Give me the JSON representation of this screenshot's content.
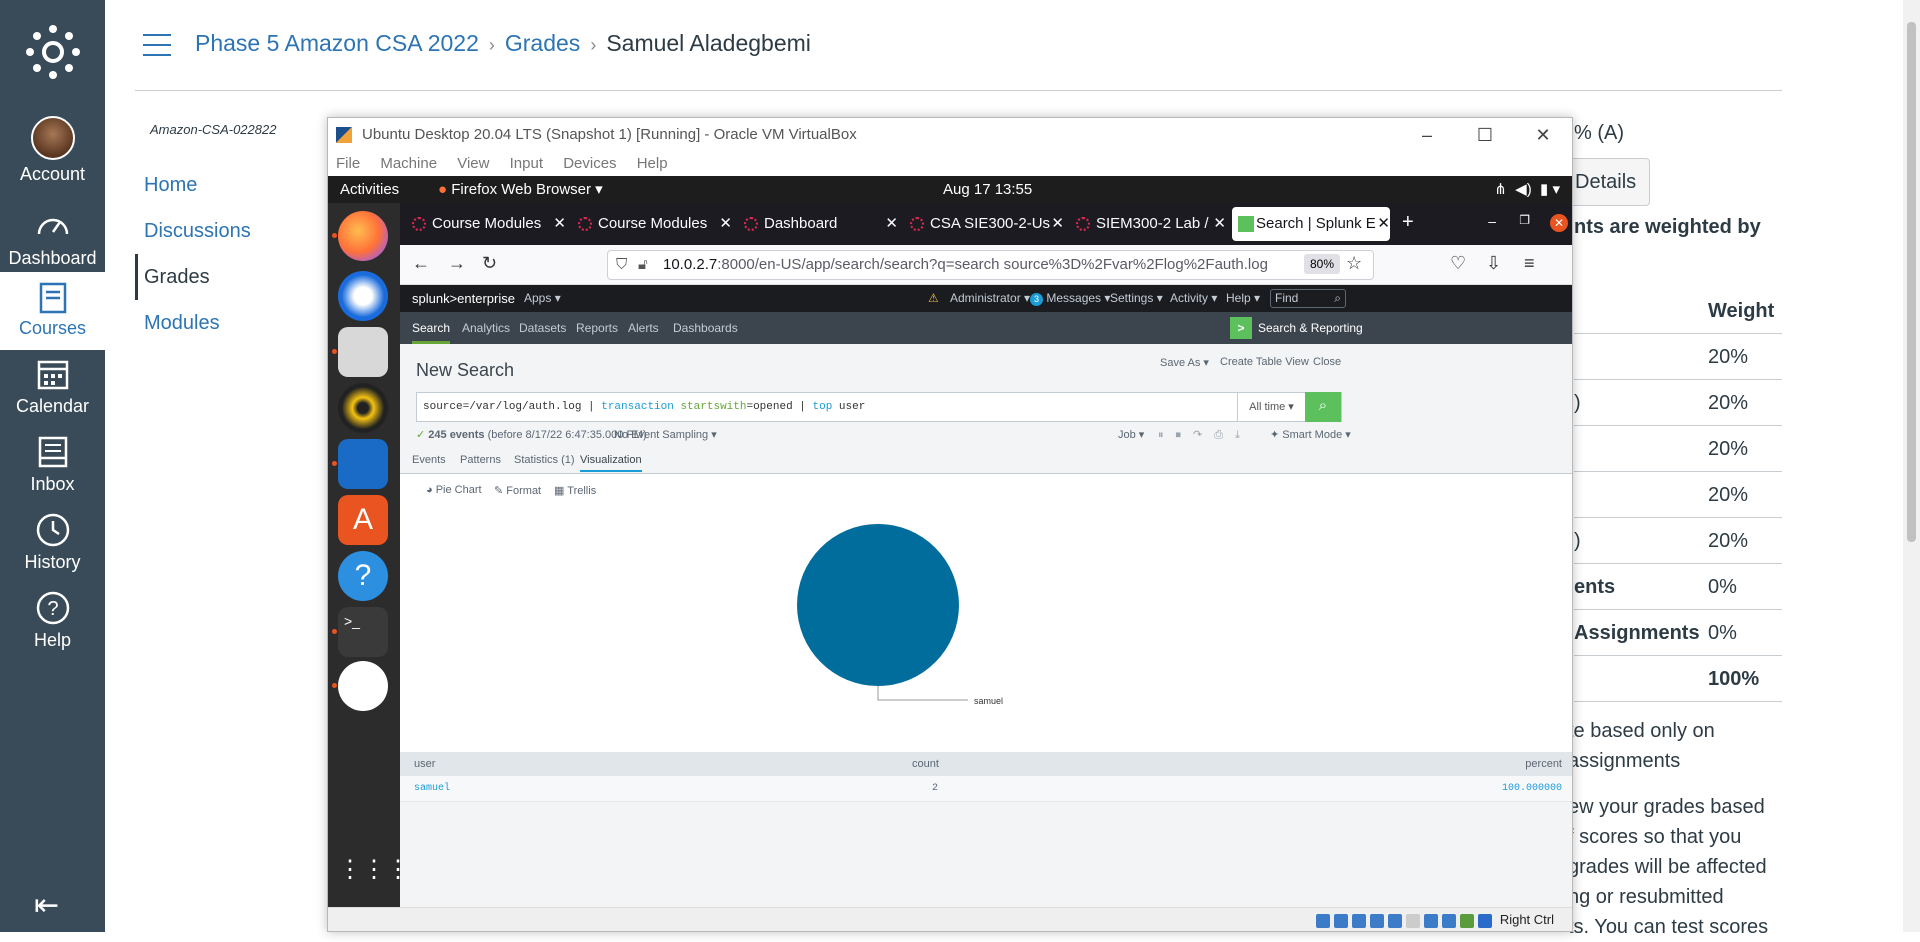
{
  "global_nav": {
    "items": [
      {
        "label": "Account"
      },
      {
        "label": "Dashboard"
      },
      {
        "label": "Courses"
      },
      {
        "label": "Calendar"
      },
      {
        "label": "Inbox"
      },
      {
        "label": "History"
      },
      {
        "label": "Help"
      }
    ]
  },
  "breadcrumb": {
    "course": "Phase 5 Amazon CSA 2022",
    "section": "Grades",
    "student": "Samuel Aladegbemi"
  },
  "course_nav": {
    "code": "Amazon-CSA-022822",
    "items": [
      {
        "label": "Home"
      },
      {
        "label": "Discussions"
      },
      {
        "label": "Grades"
      },
      {
        "label": "Modules"
      }
    ]
  },
  "right_panel": {
    "grade_fragment": "% (A)",
    "details_fragment": "Details",
    "weighted_fragment": "nts are weighted by",
    "weight_header": "Weight",
    "rows": [
      {
        "label": "",
        "weight": "20%"
      },
      {
        "label": ")",
        "weight": "20%"
      },
      {
        "label": "",
        "weight": "20%"
      },
      {
        "label": "",
        "weight": "20%"
      },
      {
        "label": ")",
        "weight": "20%"
      },
      {
        "label": "ents",
        "weight": "0%"
      },
      {
        "label": "Assignments",
        "weight": "0%"
      },
      {
        "label": "",
        "weight": "100%"
      }
    ],
    "text_lines": [
      "te based only on",
      "assignments",
      "",
      "ew your grades based",
      "f scores so that you",
      "grades will be affected",
      "ng or resubmitted",
      "ts. You can test scores"
    ]
  },
  "vbox": {
    "title": "Ubuntu Desktop 20.04 LTS (Snapshot 1) [Running] - Oracle VM VirtualBox",
    "menu": [
      "File",
      "Machine",
      "View",
      "Input",
      "Devices",
      "Help"
    ],
    "host_key": "Right Ctrl"
  },
  "ubuntu": {
    "activities": "Activities",
    "app_name": "Firefox Web Browser",
    "clock": "Aug 17  13:55"
  },
  "firefox": {
    "tabs": [
      {
        "label": "Course Modules"
      },
      {
        "label": "Course Modules"
      },
      {
        "label": "Dashboard"
      },
      {
        "label": "CSA SIE300-2-Us"
      },
      {
        "label": "SIEM300-2 Lab /"
      },
      {
        "label": "Search | Splunk E"
      }
    ],
    "url_host": "10.0.2.7",
    "url_rest": ":8000/en-US/app/search/search?q=search source%3D%2Fvar%2Flog%2Fauth.log",
    "zoom": "80%"
  },
  "splunk": {
    "logo": "splunk>enterprise",
    "apps": "Apps",
    "top_right": [
      "Administrator",
      "Messages",
      "Settings",
      "Activity",
      "Help"
    ],
    "messages_count": "3",
    "find_placeholder": "Find",
    "app_nav": [
      "Search",
      "Analytics",
      "Datasets",
      "Reports",
      "Alerts",
      "Dashboards"
    ],
    "app_title": "Search & Reporting",
    "page_title": "New Search",
    "actions": [
      "Save As",
      "Create Table View",
      "Close"
    ],
    "query": {
      "p1": "source=/var/log/auth.log | ",
      "k1": "transaction",
      "a1": " startswith",
      "p2": "=opened | ",
      "k2": "top",
      "p3": " user"
    },
    "time_range": "All time",
    "events_count": "245 events",
    "events_detail": "(before 8/17/22 6:47:35.000 PM)",
    "sampling": "No Event Sampling",
    "job_label": "Job",
    "mode": "Smart Mode",
    "result_tabs": [
      "Events",
      "Patterns",
      "Statistics (1)",
      "Visualization"
    ],
    "viz_tools": [
      "Pie Chart",
      "Format",
      "Trellis"
    ],
    "table": {
      "headers": [
        "user",
        "count",
        "percent"
      ],
      "rows": [
        [
          "samuel",
          "2",
          "100.000000"
        ]
      ]
    }
  },
  "chart_data": {
    "type": "pie",
    "categories": [
      "samuel"
    ],
    "values": [
      2
    ],
    "colors": [
      "#006d9c"
    ]
  }
}
